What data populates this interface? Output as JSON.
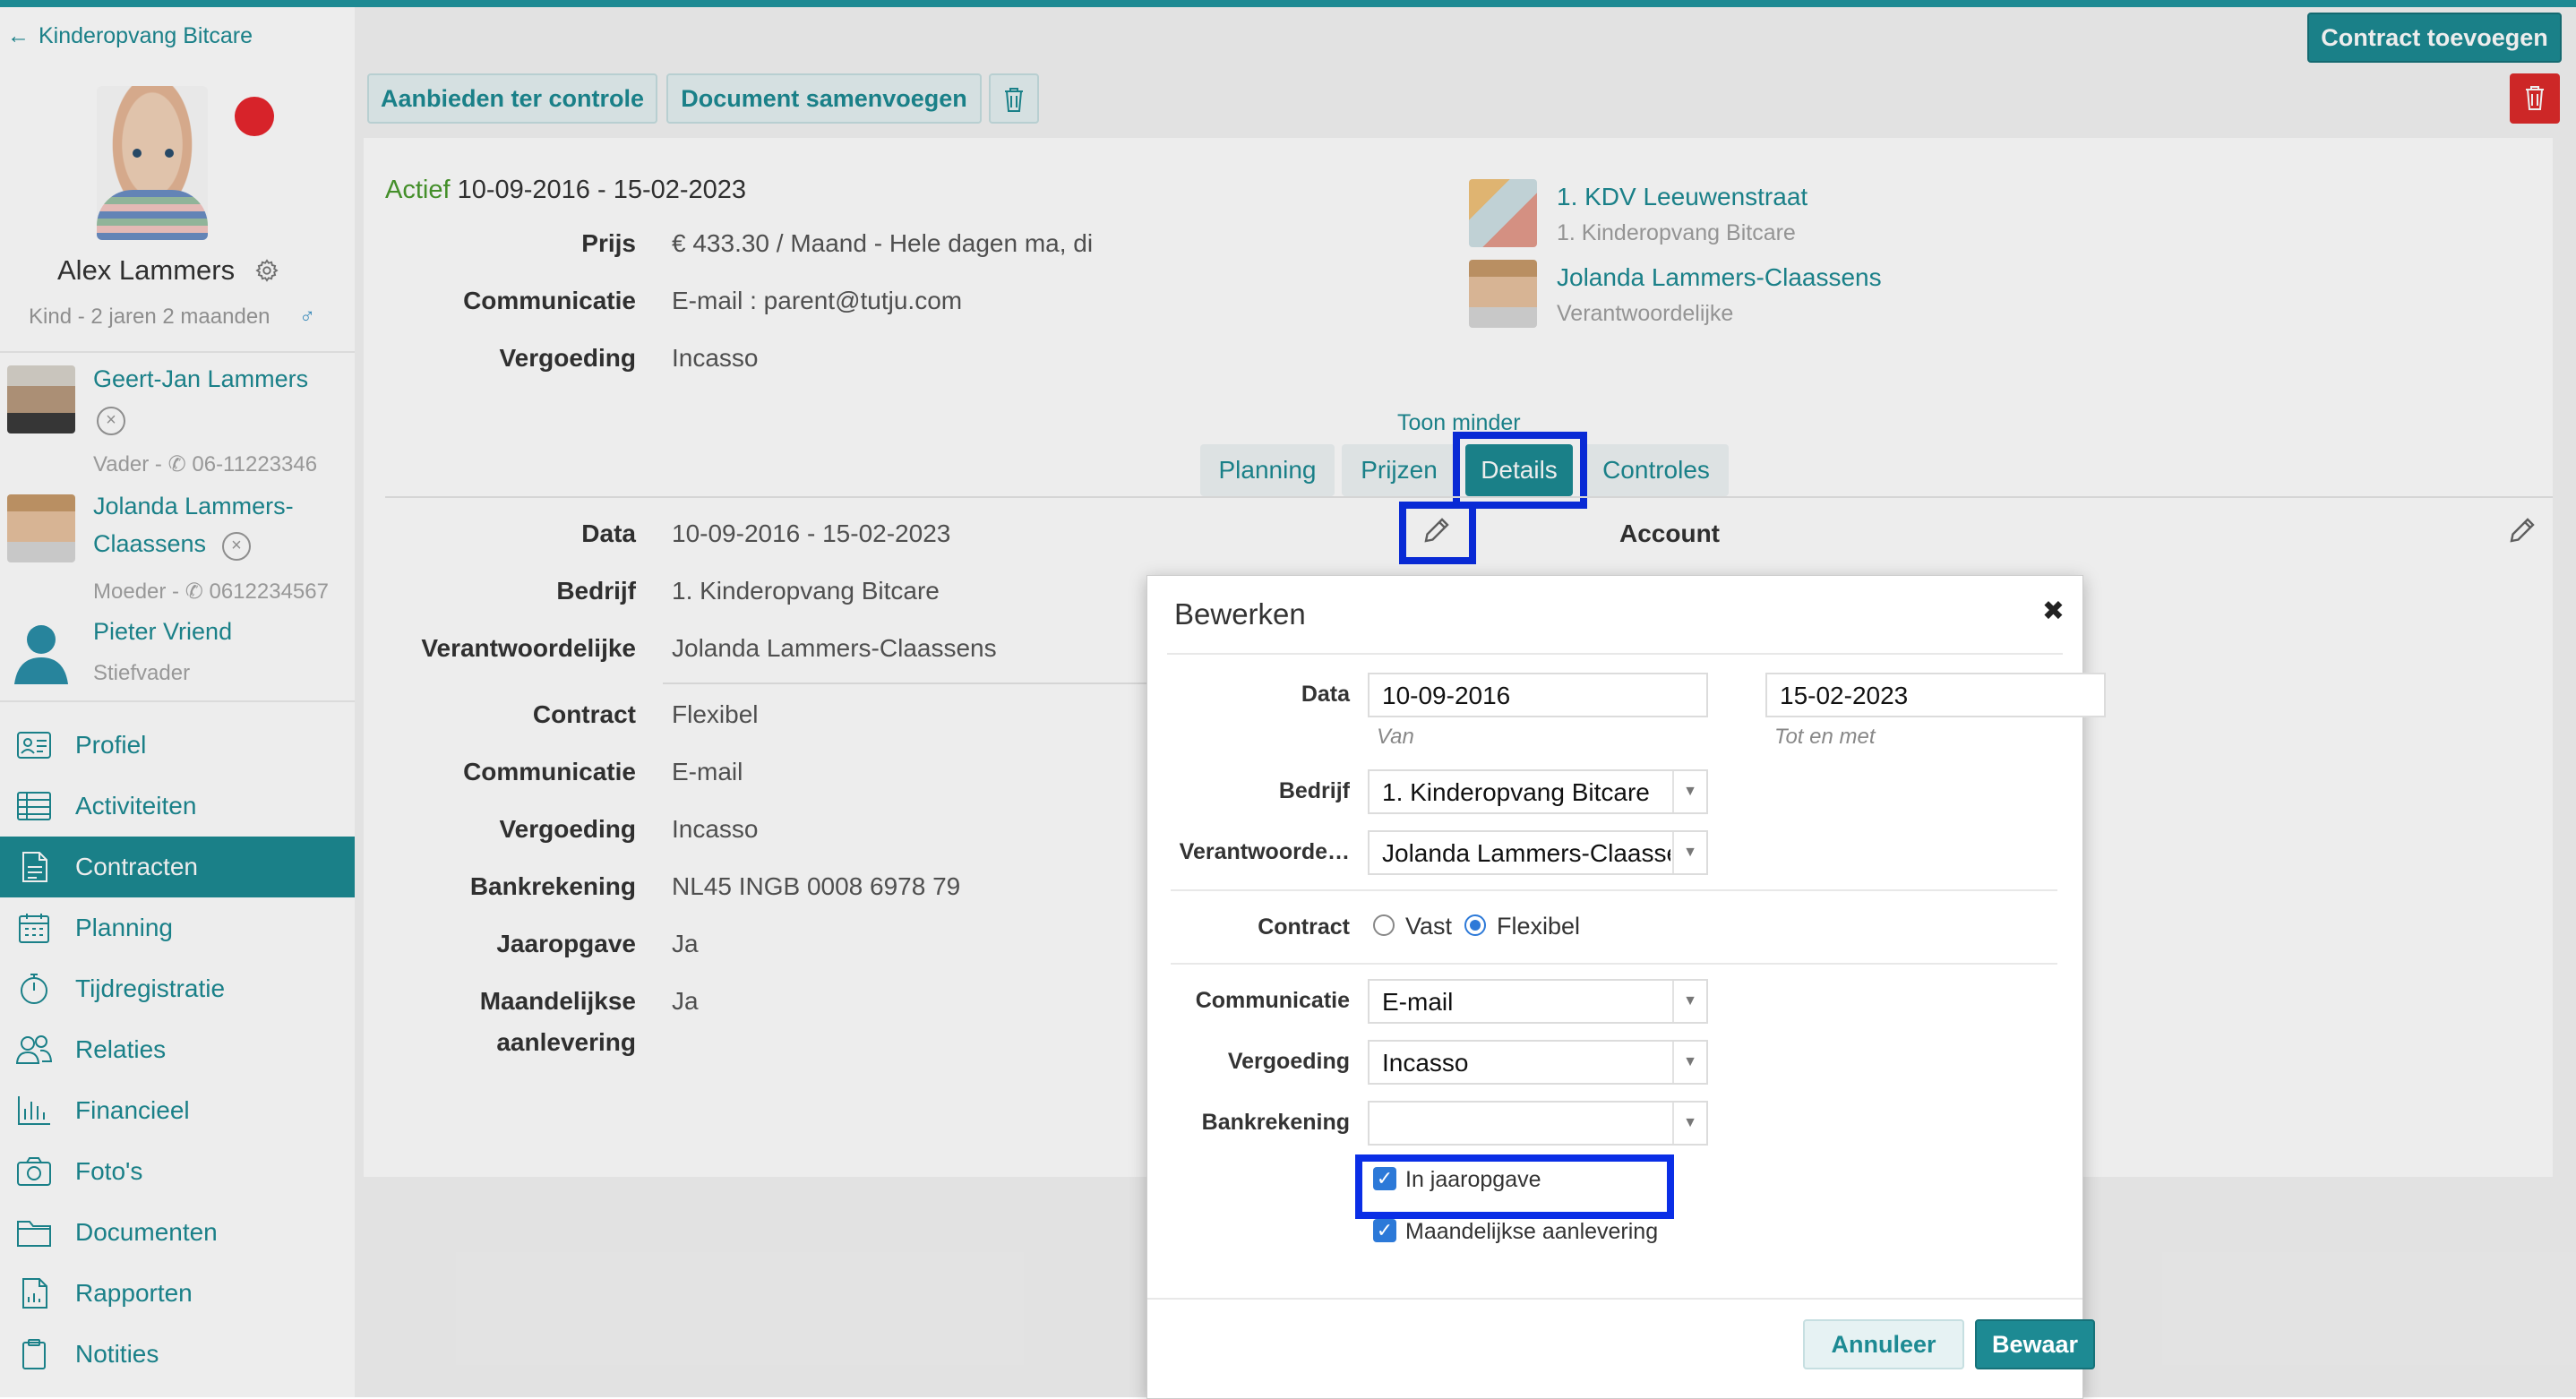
{
  "sidebar": {
    "back_label": "Kinderopvang Bitcare",
    "child": {
      "name": "Alex Lammers",
      "subtitle": "Kind - 2 jaren 2 maanden"
    },
    "relations": [
      {
        "name": "Geert-Jan Lammers",
        "sub": "Vader - ✆ 06-11223346"
      },
      {
        "name_line1": "Jolanda Lammers-",
        "name_line2": "Claassens",
        "sub": "Moeder - ✆ 0612234567"
      },
      {
        "name": "Pieter Vriend",
        "sub": "Stiefvader"
      }
    ],
    "nav": [
      {
        "label": "Profiel",
        "icon": "profile-card-icon"
      },
      {
        "label": "Activiteiten",
        "icon": "table-icon"
      },
      {
        "label": "Contracten",
        "icon": "contract-icon",
        "active": true
      },
      {
        "label": "Planning",
        "icon": "calendar-icon"
      },
      {
        "label": "Tijdregistratie",
        "icon": "stopwatch-icon"
      },
      {
        "label": "Relaties",
        "icon": "people-icon"
      },
      {
        "label": "Financieel",
        "icon": "bar-chart-icon"
      },
      {
        "label": "Foto's",
        "icon": "camera-icon"
      },
      {
        "label": "Documenten",
        "icon": "folder-icon"
      },
      {
        "label": "Rapporten",
        "icon": "report-icon"
      },
      {
        "label": "Notities",
        "icon": "clipboard-icon"
      }
    ]
  },
  "header": {
    "add_contract": "Contract toevoegen",
    "offer_review": "Aanbieden ter controle",
    "merge_document": "Document samenvoegen"
  },
  "contract": {
    "status": "Actief",
    "period": "10-09-2016 - 15-02-2023",
    "summary": [
      {
        "label": "Prijs",
        "value": "€ 433.30 / Maand - Hele dagen ma, di"
      },
      {
        "label": "Communicatie",
        "value": "E-mail : parent@tutju.com"
      },
      {
        "label": "Vergoeding",
        "value": "Incasso"
      }
    ],
    "location": {
      "name": "1. KDV Leeuwenstraat",
      "sub": "1. Kinderopvang Bitcare"
    },
    "responsible": {
      "name": "Jolanda Lammers-Claassens",
      "sub": "Verantwoordelijke"
    },
    "show_less": "Toon minder",
    "tabs": [
      "Planning",
      "Prijzen",
      "Details",
      "Controles"
    ],
    "active_tab": "Details",
    "details": [
      {
        "label": "Data",
        "value": "10-09-2016 - 15-02-2023"
      },
      {
        "label": "Bedrijf",
        "value": "1. Kinderopvang Bitcare"
      },
      {
        "label": "Verantwoordelijke",
        "value": "Jolanda Lammers-Claassens"
      },
      {
        "label": "Contract",
        "value": "Flexibel"
      },
      {
        "label": "Communicatie",
        "value": "E-mail"
      },
      {
        "label": "Vergoeding",
        "value": "Incasso"
      },
      {
        "label": "Bankrekening",
        "value": "NL45 INGB 0008 6978 79"
      },
      {
        "label": "Jaaropgave",
        "value": "Ja"
      },
      {
        "label_line1": "Maandelijkse",
        "label_line2": "aanlevering",
        "value": "Ja"
      }
    ],
    "account_label": "Account"
  },
  "modal": {
    "title": "Bewerken",
    "close": "✖",
    "data_label": "Data",
    "date_from": "10-09-2016",
    "date_from_hint": "Van",
    "date_to": "15-02-2023",
    "date_to_hint": "Tot en met",
    "company_label": "Bedrijf",
    "company_value": "1. Kinderopvang Bitcare",
    "responsible_label": "Verantwoorde…",
    "responsible_value": "Jolanda Lammers-Claassens",
    "contract_label": "Contract",
    "contract_options": [
      "Vast",
      "Flexibel"
    ],
    "contract_selected": "Flexibel",
    "communication_label": "Communicatie",
    "communication_value": "E-mail",
    "compensation_label": "Vergoeding",
    "compensation_value": "Incasso",
    "bank_label": "Bankrekening",
    "bank_value": "",
    "checkbox_annual": "In jaaropgave",
    "checkbox_annual_checked": true,
    "checkbox_monthly": "Maandelijkse aanlevering",
    "checkbox_monthly_checked": true,
    "cancel": "Annuleer",
    "save": "Bewaar"
  },
  "colors": {
    "accent": "#1d8a93",
    "danger": "#dd2a2a",
    "status_active": "#4a9a2e",
    "highlight": "#0a2ee6"
  }
}
